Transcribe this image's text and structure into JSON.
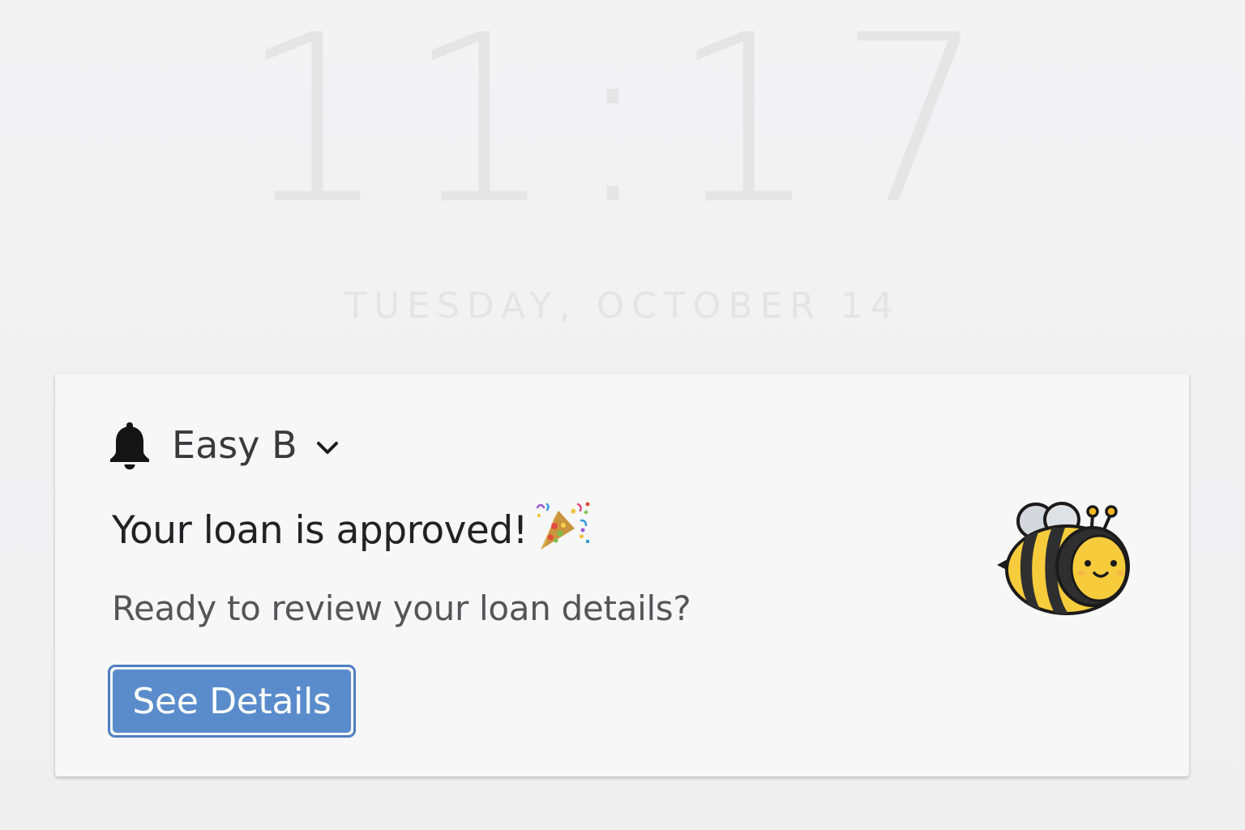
{
  "lock_screen": {
    "time": "11:17",
    "date": "TUESDAY, OCTOBER 14"
  },
  "notification": {
    "app_icon": "bell-icon",
    "app_name": "Easy B",
    "expand_icon": "chevron-down-icon",
    "title": "Your loan is approved!",
    "title_emoji": "party-popper-icon",
    "body": "Ready to review your loan details?",
    "action_label": "See Details",
    "thumbnail_icon": "bee-icon"
  },
  "colors": {
    "button_fill": "#5a8ccc",
    "button_border": "#4d7fc2",
    "card_background": "#f7f7f8",
    "bee_yellow": "#f6cc3c"
  }
}
